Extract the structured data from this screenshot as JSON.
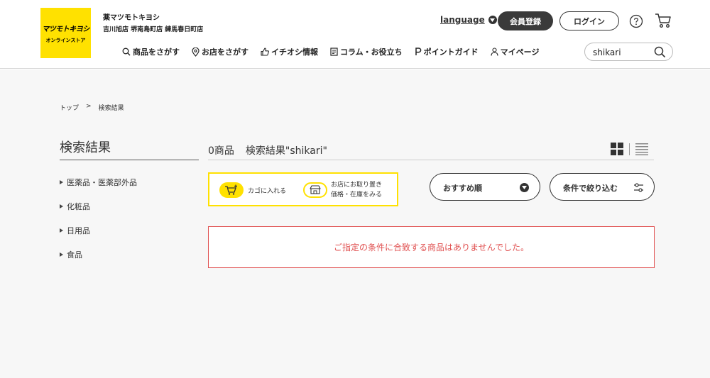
{
  "header": {
    "logo_main": "マツモトキヨシ",
    "logo_sub": "オンラインストア",
    "store_name": "薬マツモトキヨシ",
    "store_list": "吉川旭店 堺南島町店 練馬春日町店",
    "language_label": "language",
    "register_label": "会員登録",
    "login_label": "ログイン"
  },
  "nav": {
    "items": [
      {
        "label": "商品をさがす",
        "icon": "search-icon"
      },
      {
        "label": "お店をさがす",
        "icon": "location-pin-icon"
      },
      {
        "label": "イチオシ情報",
        "icon": "thumbs-up-icon"
      },
      {
        "label": "コラム・お役立ち",
        "icon": "document-icon"
      },
      {
        "label": "ポイントガイド",
        "icon": "point-p-icon"
      },
      {
        "label": "マイページ",
        "icon": "user-icon"
      }
    ]
  },
  "search": {
    "value": "shikari"
  },
  "breadcrumb": {
    "home": "トップ",
    "separator": ">",
    "current": "検索結果"
  },
  "sidebar": {
    "title": "検索結果",
    "categories": [
      "医薬品・医薬部外品",
      "化粧品",
      "日用品",
      "食品"
    ]
  },
  "results": {
    "count": "0商品",
    "query_label": "検索結果\"shikari\"",
    "empty_message": "ご指定の条件に合致する商品はありませんでした。"
  },
  "legend": {
    "cart_text": "カゴに入れる",
    "shop_line1": "お店にお取り置き",
    "shop_line2": "価格・在庫をみる"
  },
  "controls": {
    "sort_label": "おすすめ順",
    "filter_label": "条件で絞り込む"
  },
  "colors": {
    "brand_yellow": "#ffe100",
    "error_red": "#e05050",
    "dark_button": "#3a3a3a"
  }
}
